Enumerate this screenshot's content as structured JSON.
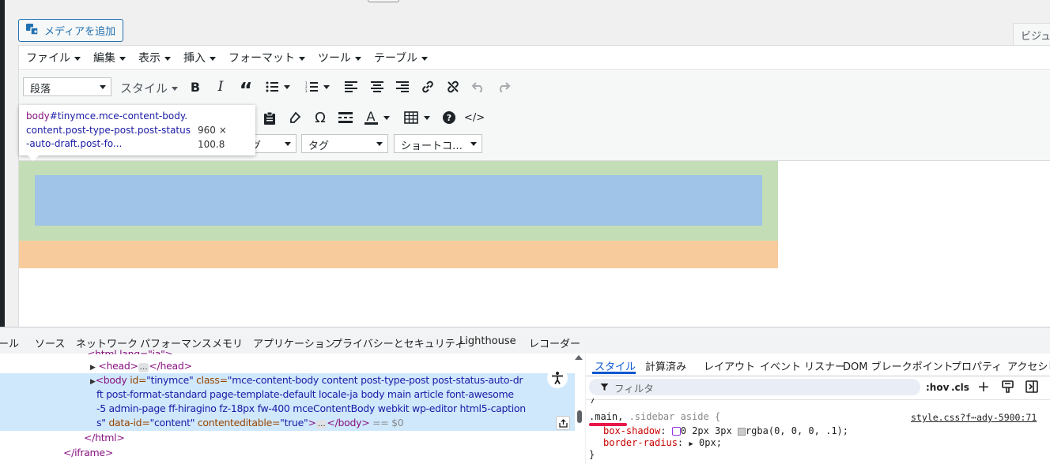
{
  "editor": {
    "media_button": "メディアを追加",
    "visual_tab": "ビジュ",
    "menu": [
      "ファイル",
      "編集",
      "表示",
      "挿入",
      "フォーマット",
      "ツール",
      "テーブル"
    ],
    "block_select": "段落",
    "style_select": "スタイル",
    "row3_select1_partial": "グ",
    "tag_select": "タグ",
    "shortcode_select": "ショートコ…"
  },
  "tooltip": {
    "selector_tag": "body",
    "selector_rest": "#tinymce.mce-content-body.content.post-type-post.post-status-auto-draft.post-fo...",
    "dims": "960 × 100.8"
  },
  "devtools": {
    "tabs": [
      "ール",
      "ソース",
      "ネットワーク",
      "パフォーマンス",
      "メモリ",
      "アプリケーション",
      "プライバシーとセキュリティ",
      "Lighthouse",
      "レコーダー"
    ],
    "elements": {
      "line_top": "<html lang=\"ja\">",
      "head_line": "<head>",
      "head_close": "</head>",
      "body_open_tag": "<body",
      "body_id_attr": " id=",
      "body_id_val": "\"tinymce\"",
      "body_class_attr": " class=",
      "body_class_val_1": "\"mce-content-body content post-type-post post-status-auto-dr",
      "body_class_val_2": "ft post-format-standard page-template-default locale-ja body main article font-awesome",
      "body_class_val_3": "-5 admin-page ff-hiragino fz-18px fw-400 mceContentBody webkit wp-editor html5-caption",
      "body_class_val_4": "s\"",
      "body_dataid_attr": " data-id=",
      "body_dataid_val": "\"content\"",
      "body_ce_attr": " contenteditable=",
      "body_ce_val": "\"true\"",
      "body_close": "</body>",
      "body_ref": "== $0",
      "html_close": "</html>",
      "iframe_close": "</iframe>"
    },
    "styles": {
      "tabs": [
        "スタイル",
        "計算済み",
        "レイアウト",
        "イベント リスナー",
        "DOM ブレークポイント",
        "プロパティ",
        "アクセシビ"
      ],
      "filter_placeholder": "フィルタ",
      "hov": ":hov",
      "cls": ".cls",
      "selector_main": ".main,",
      "selector_rest": " .sidebar aside {",
      "source": "style.css?f⋯ady-5900:71",
      "prop1_name": "box-shadow",
      "prop1_value": "0 2px 3px ",
      "prop1_color": "rgba(0, 0, 0, .1);",
      "prop2_name": "border-radius",
      "prop2_value": "0px;",
      "close_brace": "}",
      "open_brace_partial": "/"
    }
  },
  "colors": {
    "wp_blue": "#2271b1",
    "content_green": "#c3deb7",
    "content_blue": "#9fc4e7",
    "content_orange": "#f8cb9c",
    "devtools_selected": "#cfe8fc",
    "annotation_red": "#e8174a"
  }
}
